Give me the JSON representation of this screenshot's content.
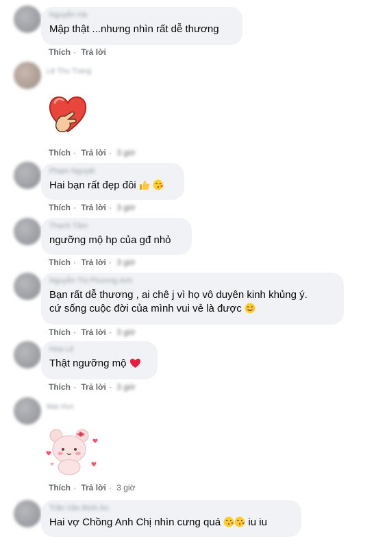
{
  "actions": {
    "like": "Thích",
    "reply": "Trả lời",
    "sep": "·"
  },
  "comments": [
    {
      "name": "Nguyễn Hà",
      "text": "Mập thật ...nhưng nhìn rất dễ thương",
      "time": ""
    },
    {
      "name": "Lê Thu Trang",
      "sticker": "heart-hand-sticker",
      "time": "3 giờ"
    },
    {
      "name": "Phạm Nguyệt",
      "text": "Hai bạn rất đẹp đôi",
      "emojis": [
        "thumbs-up-icon",
        "kiss-face-icon"
      ],
      "time": "3 giờ"
    },
    {
      "name": "Thanh Tâm",
      "text": "ngưỡng mộ hp của gđ nhỏ",
      "time": "3 giờ"
    },
    {
      "name": "Nguyễn Thị Phương Anh",
      "text": "Bạn rất dễ thương , ai chê j vì họ vô duyên kinh khủng ý.",
      "text2": "cứ sống cuộc đời của mình vui vẻ là được",
      "emojis": [
        "smiling-face-icon"
      ],
      "time": "3 giờ"
    },
    {
      "name": "Hoa Lê",
      "text": "Thật ngưỡng mộ",
      "emojis": [
        "red-heart-icon"
      ],
      "time": "3 giờ"
    },
    {
      "name": "Mai Hương",
      "sticker": "pink-bear-sticker",
      "time": "3 giờ"
    },
    {
      "name": "Trần Văn Bình An",
      "text": "Hai vợ Chồng Anh Chị nhìn cưng quá",
      "emojis": [
        "kiss-face-icon",
        "kiss-face-icon"
      ],
      "text_after": "iu iu",
      "time": ""
    }
  ],
  "colors": {
    "bubble": "#f0f2f5",
    "action": "#65676b",
    "text": "#050505"
  }
}
